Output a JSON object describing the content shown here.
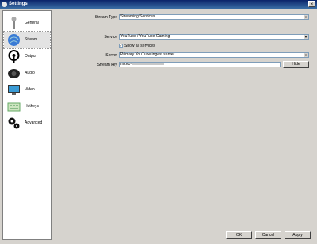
{
  "window": {
    "title": "Settings",
    "close_glyph": "×"
  },
  "sidebar": {
    "items": [
      {
        "label": "General",
        "icon": "wrench-icon"
      },
      {
        "label": "Stream",
        "icon": "globe-icon"
      },
      {
        "label": "Output",
        "icon": "broadcast-icon"
      },
      {
        "label": "Audio",
        "icon": "speaker-icon"
      },
      {
        "label": "Video",
        "icon": "monitor-icon"
      },
      {
        "label": "Hotkeys",
        "icon": "keyboard-icon"
      },
      {
        "label": "Advanced",
        "icon": "gears-icon"
      }
    ],
    "selected": "Stream"
  },
  "stream": {
    "stream_type_label": "Stream Type",
    "stream_type_value": "Streaming Services",
    "service_label": "Service",
    "service_value": "YouTube / YouTube Gaming",
    "show_all_label": "Show all services",
    "server_label": "Server",
    "server_value": "Primary YouTube ingest server",
    "key_label": "Stream key",
    "key_value": "m2k1-",
    "hide_label": "Hide"
  },
  "buttons": {
    "ok": "OK",
    "cancel": "Cancel",
    "apply": "Apply"
  },
  "colors": {
    "titlebar": "#0a246a",
    "panel": "#d6d3ce"
  }
}
